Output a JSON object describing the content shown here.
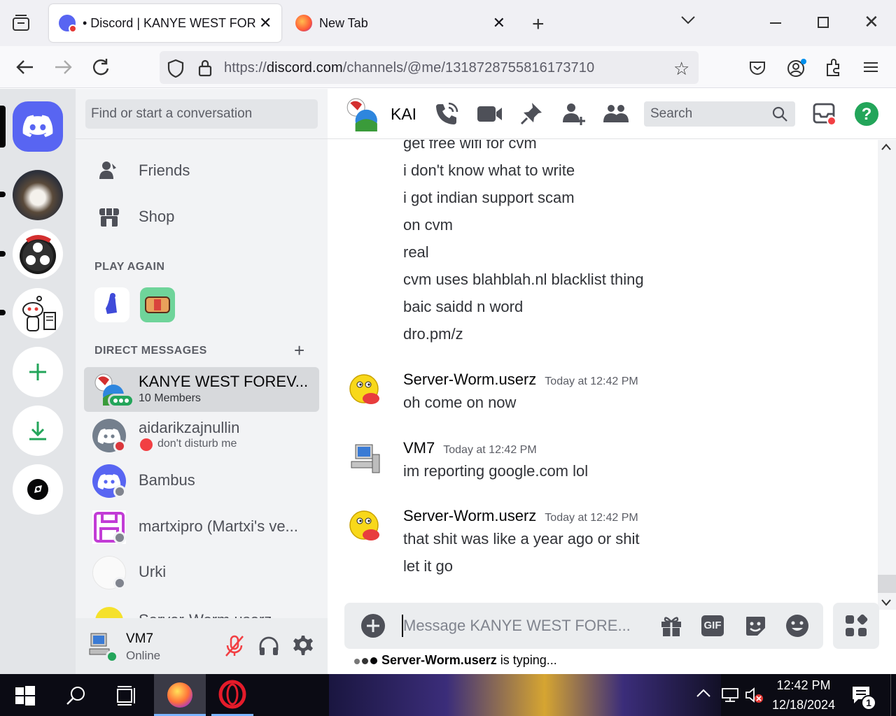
{
  "browser": {
    "tabs": [
      {
        "title": "• Discord | KANYE WEST FOREV",
        "active": true
      },
      {
        "title": "New Tab",
        "active": false
      }
    ],
    "url_prefix": "https://",
    "url_domain": "discord.com",
    "url_path": "/channels/@me/1318728755816173710"
  },
  "dm_sidebar": {
    "search_placeholder": "Find or start a conversation",
    "nav": [
      {
        "label": "Friends",
        "icon": "friends-icon"
      },
      {
        "label": "Shop",
        "icon": "shop-icon"
      }
    ],
    "play_again_label": "PLAY AGAIN",
    "direct_messages_label": "DIRECT MESSAGES",
    "dms": [
      {
        "name": "KANYE WEST FOREV...",
        "sub": "10 Members",
        "selected": true
      },
      {
        "name": "aidarikzajnullin",
        "sub": "don't disturb me",
        "status": "dnd"
      },
      {
        "name": "Bambus",
        "sub": "",
        "status": "offline"
      },
      {
        "name": "martxipro (Martxi's ve...",
        "sub": "",
        "status": "offline"
      },
      {
        "name": "Urki",
        "sub": "",
        "status": "offline"
      },
      {
        "name": "Server-Worm.userz",
        "sub": "",
        "status": "online"
      }
    ]
  },
  "user_panel": {
    "name": "VM7",
    "status": "Online"
  },
  "channel_header": {
    "name": "KAI",
    "search_placeholder": "Search"
  },
  "messages": {
    "continuation_lines": [
      "get free wifi for cvm",
      "i don't know what to write",
      "i got indian support scam",
      "on cvm",
      "real",
      "cvm uses blahblah.nl blacklist thing",
      "baic saidd n word",
      "dro.pm/z"
    ],
    "groups": [
      {
        "author": "Server-Worm.userz",
        "time": "Today at 12:42 PM",
        "lines": [
          "oh come on now"
        ]
      },
      {
        "author": "VM7",
        "time": "Today at 12:42 PM",
        "lines": [
          "im reporting google.com lol"
        ]
      },
      {
        "author": "Server-Worm.userz",
        "time": "Today at 12:42 PM",
        "lines": [
          "that shit was like a year ago or shit",
          "let it go"
        ]
      }
    ]
  },
  "composer": {
    "placeholder": "Message KANYE WEST FORE...",
    "gif_label": "GIF"
  },
  "typing": {
    "user": "Server-Worm.userz",
    "text": " is typing..."
  },
  "taskbar": {
    "time": "12:42 PM",
    "date": "12/18/2024",
    "notification_count": "1"
  },
  "colors": {
    "blurple": "#5865f2",
    "green": "#23a55a",
    "red": "#f23f43",
    "dnd": "#da373c"
  }
}
